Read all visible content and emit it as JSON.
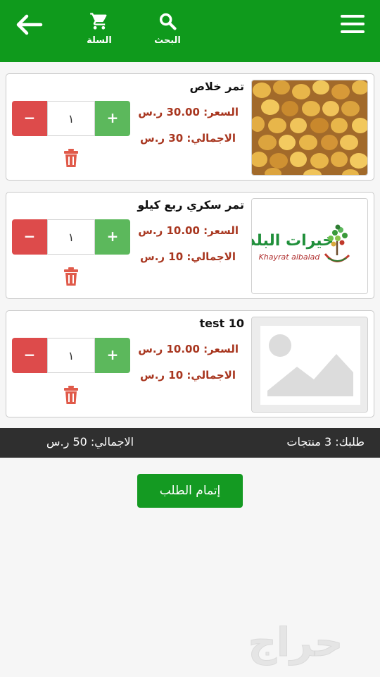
{
  "header": {
    "search_label": "البحث",
    "cart_label": "السلة",
    "back_icon": "arrow-left-icon",
    "menu_icon": "hamburger-menu-icon",
    "brand_color": "#0f9a1c"
  },
  "cart": {
    "items": [
      {
        "name": "تمر خلاص",
        "price": "السعر: 30.00 ر.س",
        "total": "الاجمالي: 30 ر.س",
        "quantity": "١",
        "image": "dates-photo"
      },
      {
        "name": "تمر سكري ربع كيلو",
        "price": "السعر: 10.00 ر.س",
        "total": "الاجمالي: 10 ر.س",
        "quantity": "١",
        "image": "logo",
        "logo_text_ar": "خيرات البلد",
        "logo_text_en": "Khayrat albalad"
      },
      {
        "name": "test 10",
        "price": "السعر: 10.00 ر.س",
        "total": "الاجمالي: 10 ر.س",
        "quantity": "١",
        "image": "placeholder"
      }
    ],
    "minus_label": "−",
    "plus_label": "+"
  },
  "summary": {
    "count_text": "طلبك: 3 منتجات",
    "total_text": "الاجمالي: 50 ر.س"
  },
  "checkout": {
    "label": "إتمام الطلب"
  },
  "watermark": {
    "text": "حراج"
  },
  "colors": {
    "minus": "#dd4b4b",
    "plus": "#5cb85c",
    "price": "#a8361f",
    "summary_bg": "#2f2f2f",
    "trash": "#e05a4a"
  }
}
